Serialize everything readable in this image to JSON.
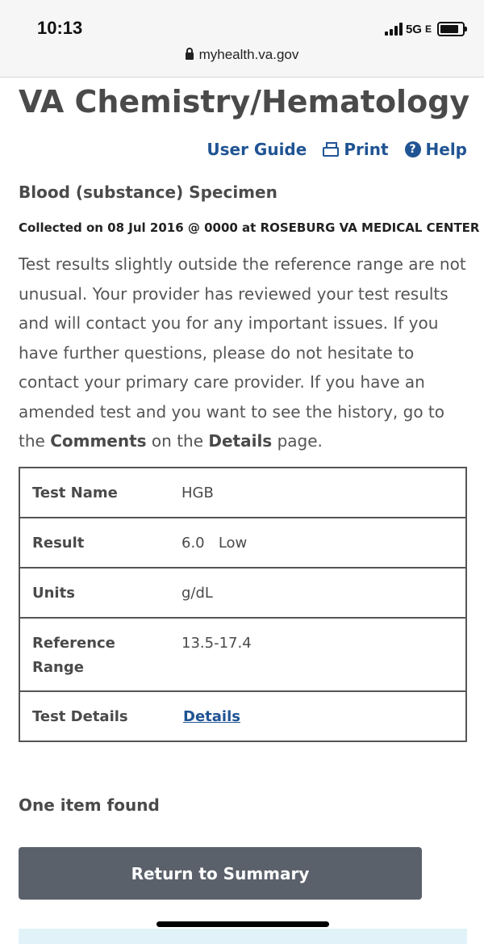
{
  "status_bar": {
    "time": "10:13",
    "network": "5G",
    "network_suffix": "E",
    "url": "myhealth.va.gov"
  },
  "page": {
    "title": "VA Chemistry/Hematology",
    "links": {
      "user_guide": "User Guide",
      "print": "Print",
      "help": "Help"
    },
    "specimen": "Blood (substance) Specimen",
    "collected": "Collected on 08 Jul 2016 @ 0000 at ROSEBURG VA MEDICAL CENTER",
    "notice_text": "Test results slightly outside the reference range are not unusual. Your provider has reviewed your test results and will contact you for any important issues. If you have further questions, please do not hesitate to contact your primary care provider. If you have an amended test and you want to see the history, go to the ",
    "notice_bold1": "Comments",
    "notice_mid": " on the ",
    "notice_bold2": "Details",
    "notice_end": " page."
  },
  "results": {
    "test_name_label": "Test Name",
    "test_name_value": "HGB",
    "result_label": "Result",
    "result_value": "6.0",
    "result_flag": "Low",
    "units_label": "Units",
    "units_value": "g/dL",
    "reference_label_line1": "Reference",
    "reference_label_line2": "Range",
    "reference_value": "13.5-17.4",
    "details_label": "Test Details",
    "details_link": "Details"
  },
  "footer": {
    "found_text": "One item found",
    "return_button": "Return to Summary"
  },
  "colors": {
    "link_blue": "#205493",
    "button_gray": "#5b616b",
    "text_gray": "#4a4a4a"
  }
}
